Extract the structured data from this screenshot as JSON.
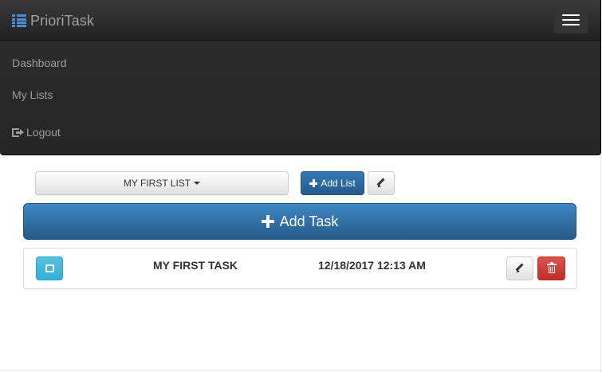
{
  "navbar": {
    "brand": "PrioriTask",
    "brand_icon": "list-icon",
    "toggle_icon": "hamburger-icon",
    "items": [
      {
        "label": "Dashboard"
      },
      {
        "label": "My Lists"
      },
      {
        "label": "Logout",
        "icon": "logout-icon"
      }
    ]
  },
  "toolbar": {
    "list_select_label": "MY FIRST LIST",
    "add_list_label": "Add List",
    "edit_list_icon": "pencil-icon"
  },
  "add_task_label": "Add Task",
  "tasks": [
    {
      "name": "MY FIRST TASK",
      "date": "12/18/2017 12:13 AM",
      "complete_icon": "checkbox-icon",
      "edit_icon": "pencil-icon",
      "delete_icon": "trash-icon"
    }
  ],
  "colors": {
    "navbar_bg": "#222222",
    "brand_icon": "#4a8fd6",
    "primary": "#337ab7",
    "info": "#5bc0de",
    "danger": "#d9534f"
  }
}
